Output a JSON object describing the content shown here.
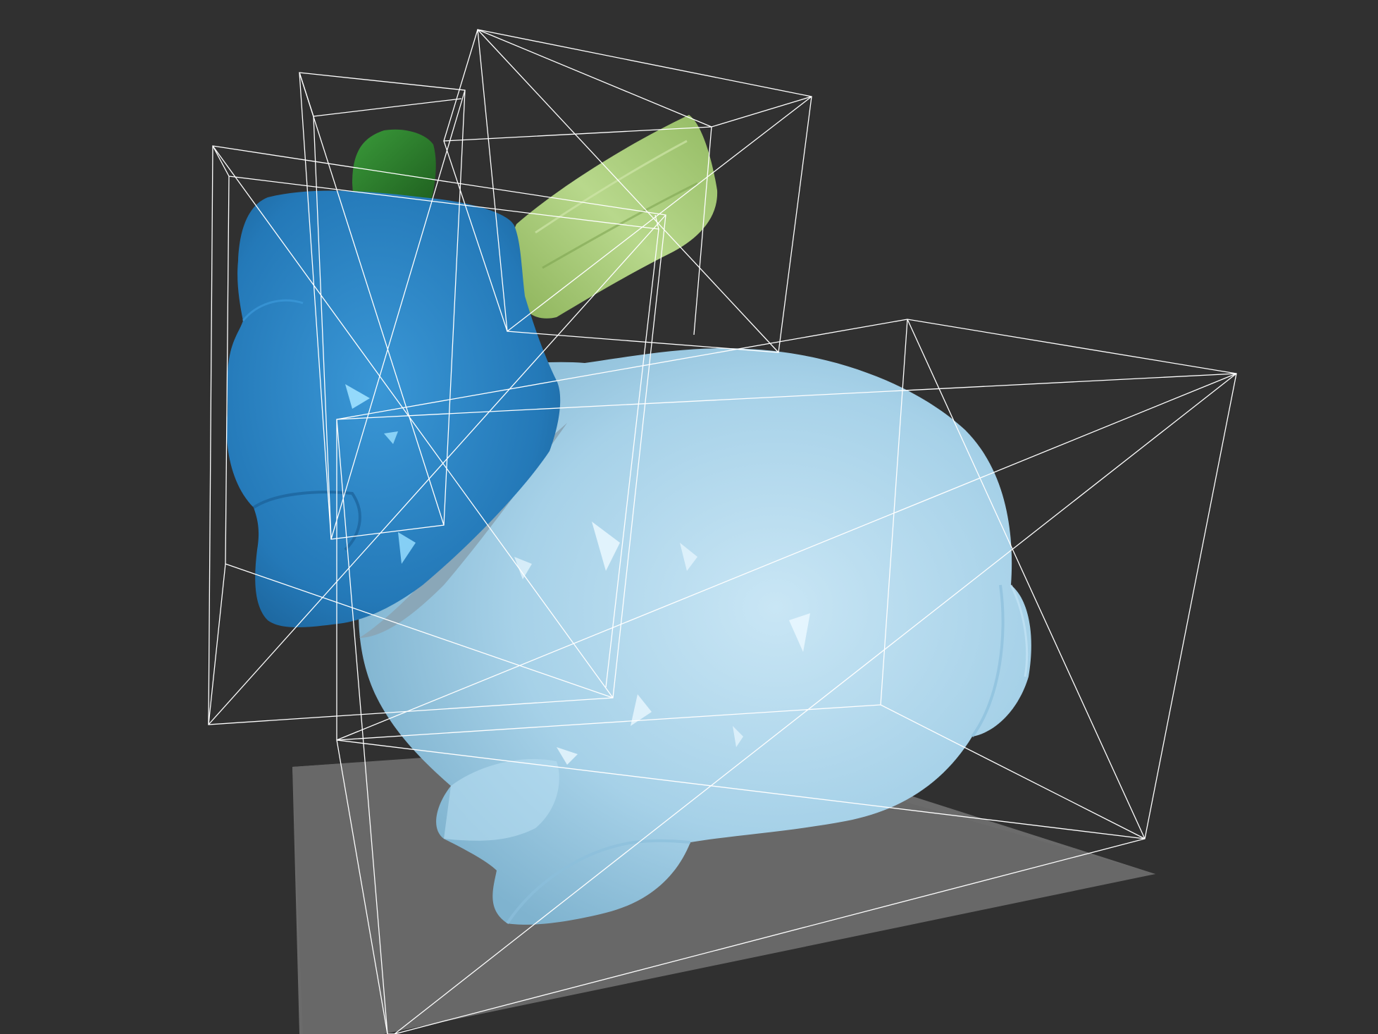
{
  "viewport": {
    "background": "#303030",
    "ground_plane_color": "#6b6b6b",
    "wireframe_color": "#ffffff"
  },
  "parts": [
    {
      "name": "body",
      "color": "#a9d3ea"
    },
    {
      "name": "head",
      "color": "#2b7fbf"
    },
    {
      "name": "ear-left",
      "color": "#2f7d2f"
    },
    {
      "name": "ear-right",
      "color": "#9dc26d"
    }
  ]
}
